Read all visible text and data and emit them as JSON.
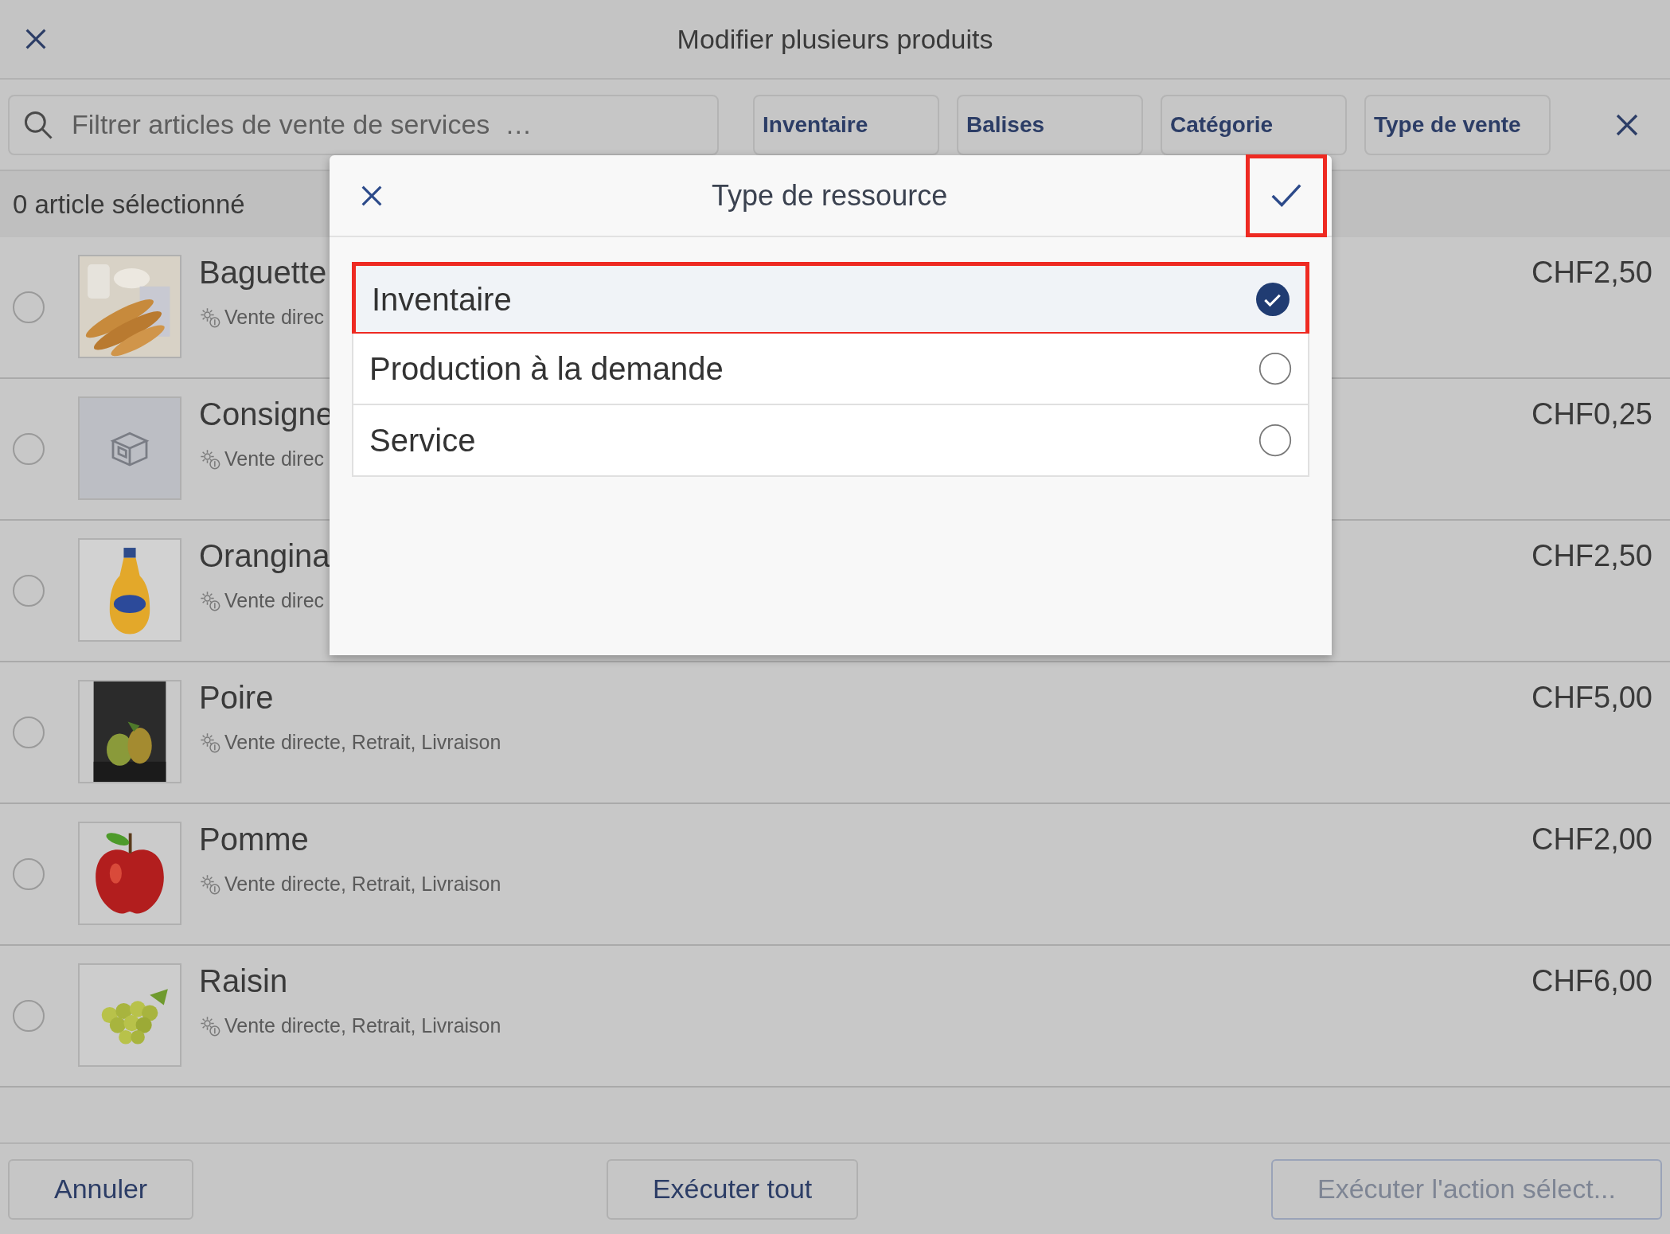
{
  "window": {
    "title": "Modifier plusieurs produits"
  },
  "search": {
    "placeholder": "Filtrer articles de vente de services  …"
  },
  "filters": [
    {
      "label": "Inventaire"
    },
    {
      "label": "Balises"
    },
    {
      "label": "Catégorie"
    },
    {
      "label": "Type de vente"
    }
  ],
  "selection_count": "0 article sélectionné",
  "products": [
    {
      "name": "Baguette",
      "channels": "Vente direc",
      "price": "CHF2,50",
      "checked": false
    },
    {
      "name": "Consigne",
      "channels": "Vente direc",
      "price": "CHF0,25",
      "checked": false,
      "kind": "placeholder"
    },
    {
      "name": "Orangina",
      "channels": "Vente direc",
      "price": "CHF2,50",
      "checked": false
    },
    {
      "name": "Poire",
      "channels": "Vente directe, Retrait, Livraison",
      "price": "CHF5,00",
      "checked": false
    },
    {
      "name": "Pomme",
      "channels": "Vente directe, Retrait, Livraison",
      "price": "CHF2,00",
      "checked": false
    },
    {
      "name": "Raisin",
      "channels": "Vente directe, Retrait, Livraison",
      "price": "CHF6,00",
      "checked": false
    }
  ],
  "footer": [
    {
      "label": "Annuler",
      "disabled": false
    },
    {
      "label": "Exécuter tout",
      "disabled": false
    },
    {
      "label": "Exécuter l'action sélect...",
      "disabled": true
    }
  ],
  "dialog": {
    "title": "Type de ressource",
    "confirm_highlighted": true,
    "options": [
      {
        "label": "Inventaire",
        "selected": true,
        "highlighted": true
      },
      {
        "label": "Production à la demande",
        "selected": false,
        "highlighted": false
      },
      {
        "label": "Service",
        "selected": false,
        "highlighted": false
      }
    ]
  }
}
